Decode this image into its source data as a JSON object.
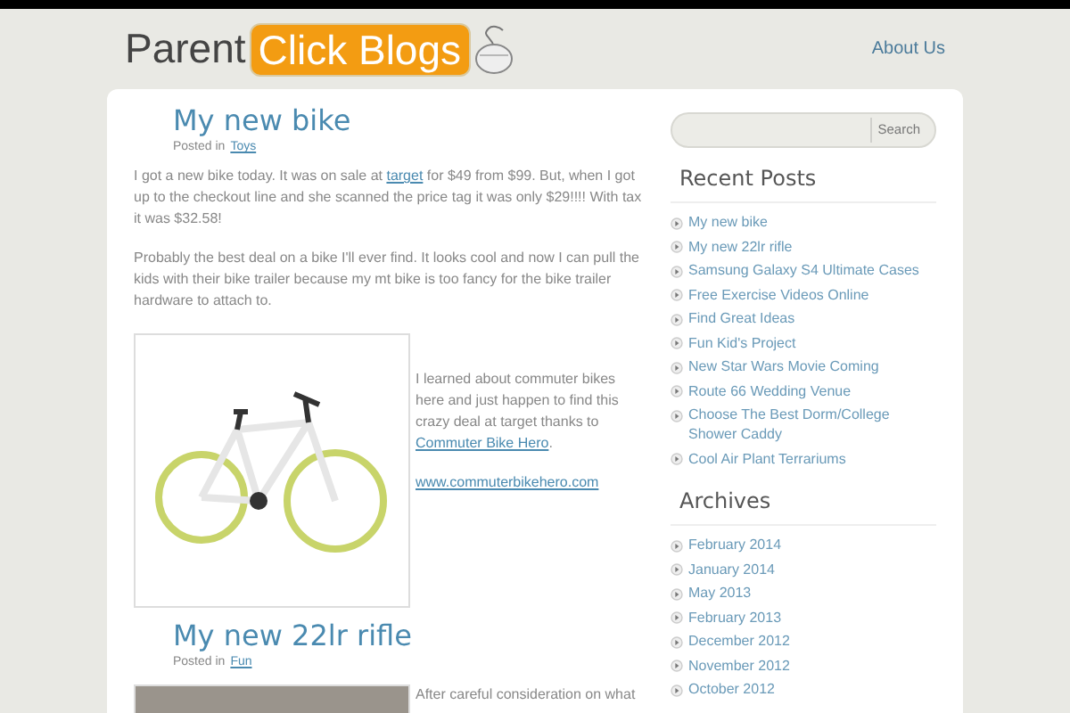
{
  "header": {
    "logo": {
      "plain": "Parent",
      "badge": "Click Blogs"
    },
    "nav": [
      {
        "label": "About Us"
      }
    ]
  },
  "posts": [
    {
      "title": "My new bike",
      "meta_label": "Posted in",
      "category": "Toys",
      "paragraphs": [
        [
          {
            "text": "I got a new bike today. It was on sale at ",
            "link": false
          },
          {
            "text": "target",
            "link": true
          },
          {
            "text": " for $49 from $99. But, when I got up to the checkout line and she scanned the price tag it was only $29!!!! With tax it was $32.58!",
            "link": false
          }
        ],
        [
          {
            "text": "Probably the best deal on a bike I'll ever find. It looks cool and now I can pull the kids with their bike trailer because my mt bike is too fancy for the bike trailer hardware to attach to.",
            "link": false
          }
        ]
      ],
      "figure": {
        "kind": "bike",
        "paragraphs": [
          [
            {
              "text": "I learned about commuter bikes here and just happen to find this crazy deal at target thanks to ",
              "link": false
            },
            {
              "text": "Commuter Bike Hero",
              "link": true
            },
            {
              "text": ".",
              "link": false
            }
          ],
          [
            {
              "text": "www.commuterbikehero.com",
              "link": true
            }
          ]
        ]
      }
    },
    {
      "title": "My new 22lr rifle",
      "meta_label": "Posted in",
      "category": "Fun",
      "figure": {
        "kind": "photo",
        "paragraphs": [
          [
            {
              "text": "After careful consideration on what",
              "link": false
            }
          ]
        ]
      }
    }
  ],
  "sidebar": {
    "search": {
      "button": "Search"
    },
    "widgets": [
      {
        "title": "Recent Posts",
        "items": [
          "My new bike",
          "My new 22lr rifle",
          "Samsung Galaxy S4 Ultimate Cases",
          "Free Exercise Videos Online",
          "Find Great Ideas",
          "Fun Kid's Project",
          "New Star Wars Movie Coming",
          "Route 66 Wedding Venue",
          "Choose The Best Dorm/College Shower Caddy",
          "Cool Air Plant Terrariums"
        ]
      },
      {
        "title": "Archives",
        "items": [
          "February 2014",
          "January 2014",
          "May 2013",
          "February 2013",
          "December 2012",
          "November 2012",
          "October 2012"
        ]
      }
    ]
  }
}
